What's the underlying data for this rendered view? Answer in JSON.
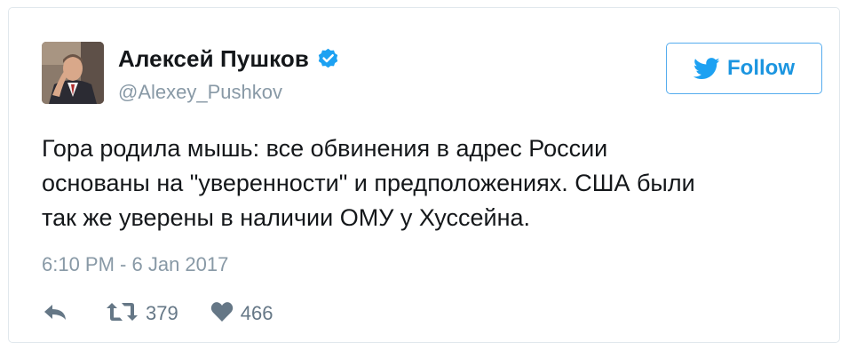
{
  "tweet": {
    "author": {
      "display_name": "Алексей Пушков",
      "handle": "@Alexey_Pushkov",
      "verified": true
    },
    "follow_button": {
      "label": "Follow",
      "icon": "twitter-bird-icon"
    },
    "text": "Гора родила мышь: все обвинения в адрес России\nоснованы на \"уверенности\" и предположениях. США были\nтак же уверены в наличии ОМУ у Хуссейна.",
    "timestamp": "6:10 PM - 6 Jan 2017",
    "actions": {
      "reply": {
        "icon": "reply-icon"
      },
      "retweet": {
        "icon": "retweet-icon",
        "count": "379"
      },
      "like": {
        "icon": "heart-icon",
        "count": "466"
      }
    }
  },
  "colors": {
    "accent": "#1b95e0",
    "border": "#e1e8ed",
    "muted": "#8899a6",
    "text": "#14171a"
  }
}
